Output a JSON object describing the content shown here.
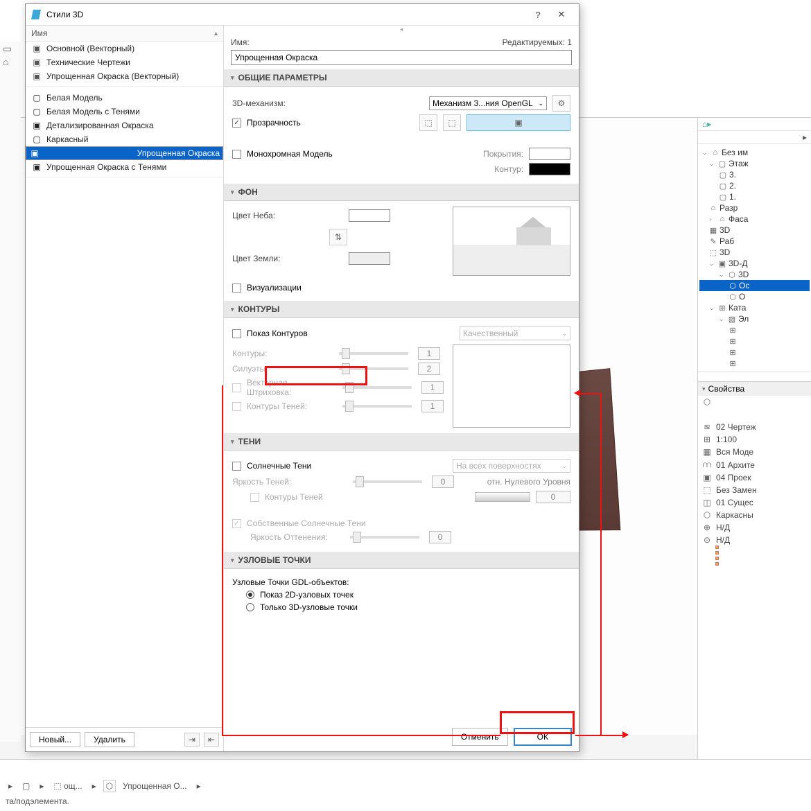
{
  "titlebar": {
    "title": "Стили 3D",
    "help": "?",
    "close": "✕"
  },
  "left": {
    "header": "Имя",
    "group1": [
      "Основной (Векторный)",
      "Технические Чертежи",
      "Упрощенная Окраска (Векторный)"
    ],
    "group2": [
      "Белая Модель",
      "Белая Модель с Тенями",
      "Детализированная Окраска",
      "Каркасный",
      "Упрощенная Окраска",
      "Упрощенная Окраска с Тенями"
    ],
    "selected": "Упрощенная Окраска",
    "new": "Новый...",
    "delete": "Удалить"
  },
  "right": {
    "name_label": "Имя:",
    "editable_label": "Редактируемых: 1",
    "name_value": "Упрощенная Окраска",
    "s_general": "ОБЩИЕ ПАРАМЕТРЫ",
    "engine_label": "3D-механизм:",
    "engine_value": "Механизм 3...ния OpenGL",
    "transparency": "Прозрачность",
    "mono": "Монохромная Модель",
    "coat": "Покрытия:",
    "contour": "Контур:",
    "s_bg": "ФОН",
    "sky": "Цвет Неба:",
    "ground": "Цвет Земли:",
    "vis": "Визуализации",
    "s_cont": "КОНТУРЫ",
    "show_cont": "Показ Контуров",
    "quality": "Качественный",
    "c1": "Контуры:",
    "c1v": "1",
    "c2": "Силуэты:",
    "c2v": "2",
    "c3": "Векторная Штриховка:",
    "c3v": "1",
    "c4": "Контуры Теней:",
    "c4v": "1",
    "s_sh": "ТЕНИ",
    "sun": "Солнечные Тени",
    "surf": "На всех поверхностях",
    "bright": "Яркость Теней:",
    "brightv": "0",
    "rel": "отн. Нулевого Уровня",
    "shc": "Контуры Теней",
    "shcv": "0",
    "own": "Собственные Солнечные Тени",
    "tint": "Яркость Оттенения:",
    "tintv": "0",
    "s_nodes": "УЗЛОВЫЕ ТОЧКИ",
    "gdl": "Узловые Точки GDL-объектов:",
    "r1": "Показ 2D-узловых точек",
    "r2": "Только 3D-узловые точки",
    "cancel": "Отменить",
    "ok": "ОК"
  },
  "nav": {
    "root": "Без им",
    "items": [
      "Этаж",
      "3.",
      "2.",
      "1.",
      "Разр",
      "Фаса",
      "3D",
      "Раб",
      "3D",
      "3D-Д",
      "3D",
      "Ос",
      "О",
      "Ката",
      "Эл"
    ],
    "props_h": "Свойства",
    "props": [
      {
        "i": "≋",
        "t": "02 Чертеж"
      },
      {
        "i": "⊞",
        "t": "1:100"
      },
      {
        "i": "▦",
        "t": "Вся Моде"
      },
      {
        "i": "⩋",
        "t": "01 Архите"
      },
      {
        "i": "▣",
        "t": "04 Проек"
      },
      {
        "i": "⬚",
        "t": "Без Замен"
      },
      {
        "i": "◫",
        "t": "01 Сущес"
      },
      {
        "i": "⬡",
        "t": "Каркасны"
      },
      {
        "i": "⊕",
        "t": "Н/Д"
      },
      {
        "i": "⊙",
        "t": "Н/Д"
      }
    ]
  },
  "status": {
    "text": "та/подэлемента.",
    "crumb": "Упрощенная О..."
  }
}
